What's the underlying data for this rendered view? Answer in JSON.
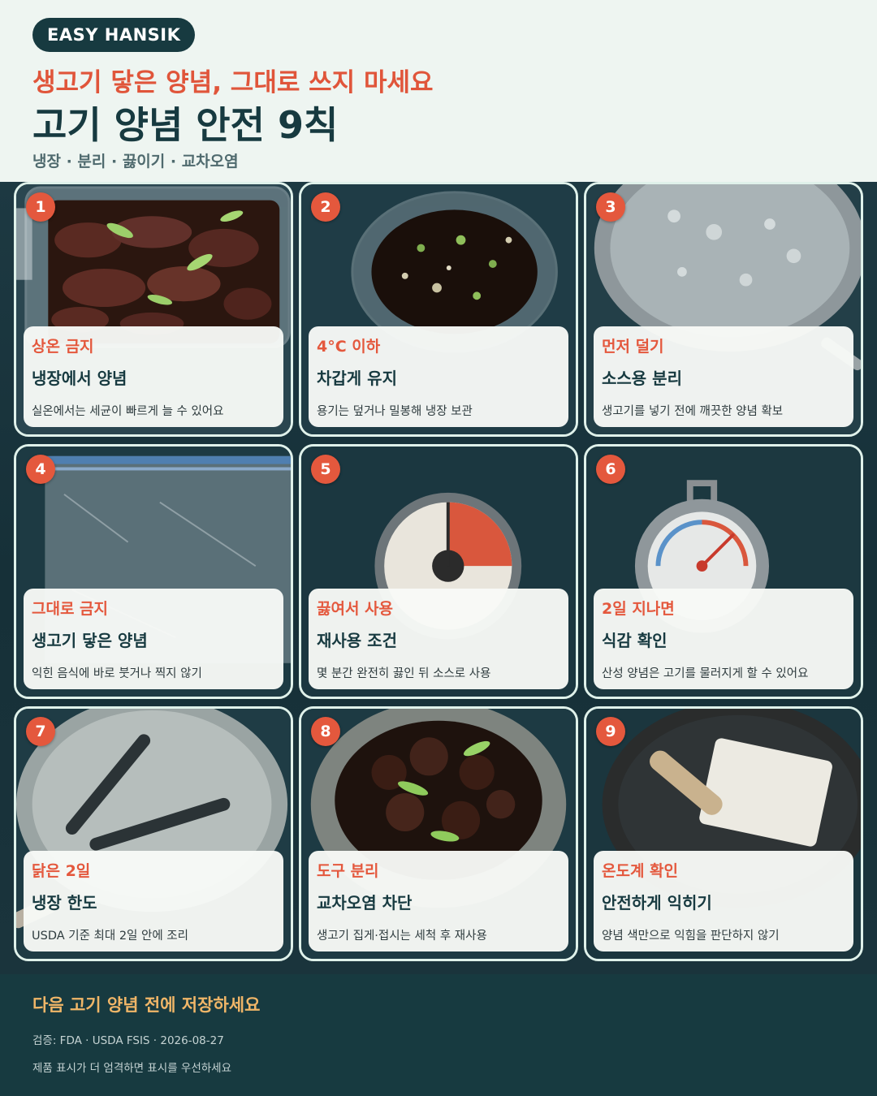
{
  "header": {
    "brand": "EASY HANSIK",
    "headline": "생고기 닿은 양념, 그대로 쓰지 마세요",
    "title": "고기 양념 안전 9칙",
    "tags": "냉장 · 분리 · 끓이기 · 교차오염"
  },
  "cards": [
    {
      "number": "1",
      "kicker": "상온 금지",
      "headline": "냉장에서 양념",
      "description": "실온에서는 세균이 빠르게 늘 수 있어요",
      "image": "marinated-beef-container"
    },
    {
      "number": "2",
      "kicker": "4°C 이하",
      "headline": "차갑게 유지",
      "description": "용기는 덮거나 밀봉해 냉장 보관",
      "image": "marinade-glass-bowl"
    },
    {
      "number": "3",
      "kicker": "먼저 덜기",
      "headline": "소스용 분리",
      "description": "생고기를 넣기 전에 깨끗한 양념 확보",
      "image": "boiling-pot"
    },
    {
      "number": "4",
      "kicker": "그대로 금지",
      "headline": "생고기 닿은 양념",
      "description": "익힌 음식에 바로 붓거나 찍지 않기",
      "image": "zip-bag"
    },
    {
      "number": "5",
      "kicker": "끓여서 사용",
      "headline": "재사용 조건",
      "description": "몇 분간 완전히 끓인 뒤 소스로 사용",
      "image": "kitchen-timer"
    },
    {
      "number": "6",
      "kicker": "2일 지나면",
      "headline": "식감 확인",
      "description": "산성 양념은 고기를 물러지게 할 수 있어요",
      "image": "fridge-thermometer"
    },
    {
      "number": "7",
      "kicker": "닭은 2일",
      "headline": "냉장 한도",
      "description": "USDA 기준 최대 2일 안에 조리",
      "image": "tongs-plate"
    },
    {
      "number": "8",
      "kicker": "도구 분리",
      "headline": "교차오염 차단",
      "description": "생고기 집게·접시는 세척 후 재사용",
      "image": "cooked-beef-bowl"
    },
    {
      "number": "9",
      "kicker": "온도계 확인",
      "headline": "안전하게 익히기",
      "description": "양념 색만으로 익힘을 판단하지 않기",
      "image": "pan-cutting-board"
    }
  ],
  "footer": {
    "cta": "다음 고기 양념 전에 저장하세요",
    "source": "검증: FDA · USDA FSIS · 2026-08-27",
    "note": "제품 표시가 더 엄격하면 표시를 우선하세요"
  },
  "colors": {
    "accent": "#e4583d",
    "dark": "#173a40",
    "background": "#eef5f1",
    "footer_cta": "#f0b668"
  }
}
